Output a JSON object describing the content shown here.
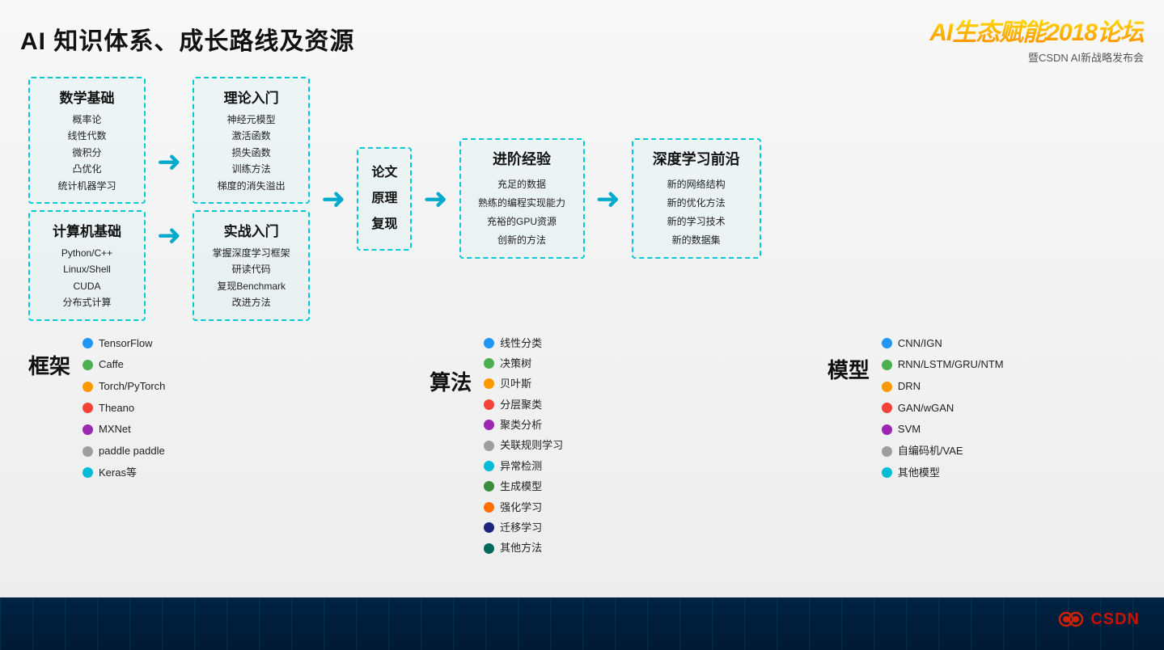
{
  "background": {
    "color": "#ffffff"
  },
  "header": {
    "main_title": "AI 知识体系、成长路线及资源",
    "logo_title": "AI生态赋能2018论坛",
    "logo_subtitle": "暨CSDN AI新战略发布会"
  },
  "flow": {
    "col1": {
      "box1_title": "数学基础",
      "box1_items": [
        "概率论",
        "线性代数",
        "微积分",
        "凸优化",
        "统计机器学习"
      ],
      "box2_title": "计算机基础",
      "box2_items": [
        "Python/C++",
        "Linux/Shell",
        "CUDA",
        "分布式计算"
      ]
    },
    "col2": {
      "box1_title": "理论入门",
      "box1_items": [
        "神经元模型",
        "激活函数",
        "损失函数",
        "训练方法",
        "梯度的消失溢出"
      ],
      "box2_title": "实战入门",
      "box2_items": [
        "掌握深度学习框架",
        "研读代码",
        "复现Benchmark",
        "改进方法"
      ]
    },
    "middle_box": {
      "lines": [
        "论文",
        "原理",
        "复现"
      ]
    },
    "progress_box": {
      "title": "进阶经验",
      "items": [
        "充足的数据",
        "熟练的编程实现能力",
        "充裕的GPU资源",
        "创新的方法"
      ]
    },
    "deep_box": {
      "title": "深度学习前沿",
      "items": [
        "新的网络结构",
        "新的优化方法",
        "新的学习技术",
        "新的数据集"
      ]
    }
  },
  "bottom": {
    "frameworks": {
      "label": "框架",
      "items": [
        {
          "color": "#2196F3",
          "text": "TensorFlow"
        },
        {
          "color": "#4CAF50",
          "text": "Caffe"
        },
        {
          "color": "#FF9800",
          "text": "Torch/PyTorch"
        },
        {
          "color": "#F44336",
          "text": "Theano"
        },
        {
          "color": "#9C27B0",
          "text": "MXNet"
        },
        {
          "color": "#9E9E9E",
          "text": "paddle paddle"
        },
        {
          "color": "#00BCD4",
          "text": "Keras等"
        }
      ]
    },
    "algorithms": {
      "label": "算法",
      "items": [
        {
          "color": "#2196F3",
          "text": "线性分类"
        },
        {
          "color": "#4CAF50",
          "text": "决策树"
        },
        {
          "color": "#FF9800",
          "text": "贝叶斯"
        },
        {
          "color": "#F44336",
          "text": "分层聚类"
        },
        {
          "color": "#9C27B0",
          "text": "聚类分析"
        },
        {
          "color": "#9E9E9E",
          "text": "关联规则学习"
        },
        {
          "color": "#00BCD4",
          "text": "异常检测"
        },
        {
          "color": "#388E3C",
          "text": "生成模型"
        },
        {
          "color": "#FF6F00",
          "text": "强化学习"
        },
        {
          "color": "#1A237E",
          "text": "迁移学习"
        },
        {
          "color": "#00695C",
          "text": "其他方法"
        }
      ]
    },
    "models": {
      "label": "模型",
      "items": [
        {
          "color": "#2196F3",
          "text": "CNN/IGN"
        },
        {
          "color": "#4CAF50",
          "text": "RNN/LSTM/GRU/NTM"
        },
        {
          "color": "#FF9800",
          "text": "DRN"
        },
        {
          "color": "#F44336",
          "text": "GAN/wGAN"
        },
        {
          "color": "#9C27B0",
          "text": "SVM"
        },
        {
          "color": "#9E9E9E",
          "text": "自编码机/VAE"
        },
        {
          "color": "#00BCD4",
          "text": "其他模型"
        }
      ]
    }
  },
  "csdn_logo": "⚙ CSDN"
}
